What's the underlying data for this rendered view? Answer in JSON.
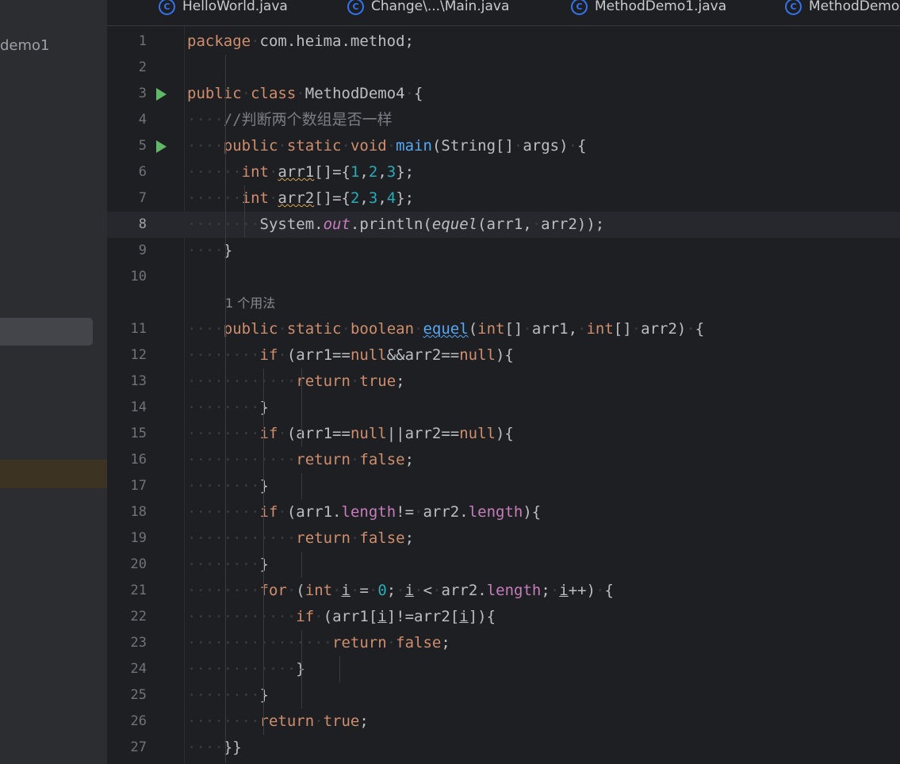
{
  "project": {
    "name": "demo1"
  },
  "tabs": [
    {
      "label": "HelloWorld.java",
      "icon": "class-c-icon"
    },
    {
      "label": "Change\\...\\Main.java",
      "icon": "class-c-icon"
    },
    {
      "label": "MethodDemo1.java",
      "icon": "class-c-icon"
    },
    {
      "label": "MethodDemo",
      "icon": "class-c-icon"
    }
  ],
  "editor": {
    "current_line": 8,
    "usage_hint": "1 个用法",
    "lines": [
      "package com.heima.method;",
      "",
      "public class MethodDemo4 {",
      "    //判断两个数组是否一样",
      "    public static void main(String[] args) {",
      "      int arr1[]={1,2,3};",
      "      int arr2[]={2,3,4};",
      "        System.out.println(equel(arr1, arr2));",
      "    }",
      "",
      "    public static boolean equel(int[] arr1, int[] arr2) {",
      "        if (arr1==null&&arr2==null){",
      "            return true;",
      "        }",
      "        if (arr1==null||arr2==null){",
      "            return false;",
      "        }",
      "        if (arr1.length!= arr2.length){",
      "            return false;",
      "        }",
      "        for (int i = 0; i < arr2.length; i++) {",
      "            if (arr1[i]!=arr2[i]){",
      "                return false;",
      "            }",
      "        }",
      "        return true;",
      "    }}"
    ]
  },
  "colors": {
    "keyword": "#cf8e6d",
    "number": "#2aacb8",
    "comment": "#7a7e85",
    "method": "#56a8f5",
    "field": "#c77dbb",
    "run_icon": "#5fb865"
  }
}
